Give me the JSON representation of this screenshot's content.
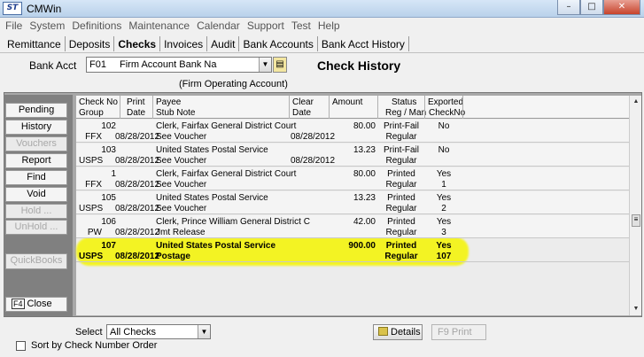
{
  "window": {
    "logo_text": "ST",
    "title": "CMWin",
    "min": "–",
    "max": "□",
    "close": "✕"
  },
  "menu": [
    "File",
    "System",
    "Definitions",
    "Maintenance",
    "Calendar",
    "Support",
    "Test",
    "Help"
  ],
  "tabs": [
    "Remittance",
    "Deposits",
    "Checks",
    "Invoices",
    "Audit",
    "Bank Accounts",
    "Bank Acct History"
  ],
  "active_tab": "Checks",
  "bank": {
    "label": "Bank Acct",
    "code": "F01",
    "name": "Firm Account Bank Na",
    "subtitle": "(Firm Operating Account)"
  },
  "page_title": "Check History",
  "sidebar": {
    "pending": "Pending",
    "history": "History",
    "vouchers": "Vouchers",
    "report": "Report",
    "find": "Find",
    "void": "Void",
    "hold": "Hold ...",
    "unhold": "UnHold ...",
    "quickbooks": "QuickBooks",
    "close_key": "F4",
    "close": "Close"
  },
  "grid": {
    "headers": {
      "check_no": "Check No",
      "group": "Group",
      "print": "Print",
      "date": "Date",
      "payee": "Payee",
      "stub_note": "Stub Note",
      "clear": "Clear",
      "clear_date": "Date",
      "amount": "Amount",
      "status": "Status",
      "reg_man": "Reg / Man",
      "exported": "Exported",
      "checkno": "CheckNo"
    },
    "rows": [
      {
        "check_no": "102",
        "group": "FFX",
        "print_date": "08/28/2012",
        "payee": "Clerk, Fairfax General District Court",
        "stub_note": "See Voucher",
        "clear_date": "08/28/2012",
        "amount": "80.00",
        "status": "Print-Fail",
        "reg_man": "Regular",
        "exported": "No",
        "export_no": ""
      },
      {
        "check_no": "103",
        "group": "USPS",
        "print_date": "08/28/2012",
        "payee": "United States Postal Service",
        "stub_note": "See Voucher",
        "clear_date": "08/28/2012",
        "amount": "13.23",
        "status": "Print-Fail",
        "reg_man": "Regular",
        "exported": "No",
        "export_no": ""
      },
      {
        "check_no": "1",
        "group": "FFX",
        "print_date": "08/28/2012",
        "payee": "Clerk, Fairfax General District Court",
        "stub_note": "See Voucher",
        "clear_date": "",
        "amount": "80.00",
        "status": "Printed",
        "reg_man": "Regular",
        "exported": "Yes",
        "export_no": "1"
      },
      {
        "check_no": "105",
        "group": "USPS",
        "print_date": "08/28/2012",
        "payee": "United States Postal Service",
        "stub_note": "See Voucher",
        "clear_date": "",
        "amount": "13.23",
        "status": "Printed",
        "reg_man": "Regular",
        "exported": "Yes",
        "export_no": "2"
      },
      {
        "check_no": "106",
        "group": "PW",
        "print_date": "08/28/2012",
        "payee": "Clerk, Prince William General District C",
        "stub_note": "Jmt Release",
        "clear_date": "",
        "amount": "42.00",
        "status": "Printed",
        "reg_man": "Regular",
        "exported": "Yes",
        "export_no": "3"
      },
      {
        "check_no": "107",
        "group": "USPS",
        "print_date": "08/28/2012",
        "payee": "United States Postal Service",
        "stub_note": "Postage",
        "clear_date": "",
        "amount": "900.00",
        "status": "Printed",
        "reg_man": "Regular",
        "exported": "Yes",
        "export_no": "107"
      }
    ]
  },
  "footer": {
    "select_label": "Select",
    "select_value": "All Checks",
    "sort_label": "Sort by Check Number Order",
    "details": "Details",
    "print": "F9 Print"
  },
  "colors": {
    "highlight": "#f5f500",
    "sidebar_bg": "#808080"
  }
}
